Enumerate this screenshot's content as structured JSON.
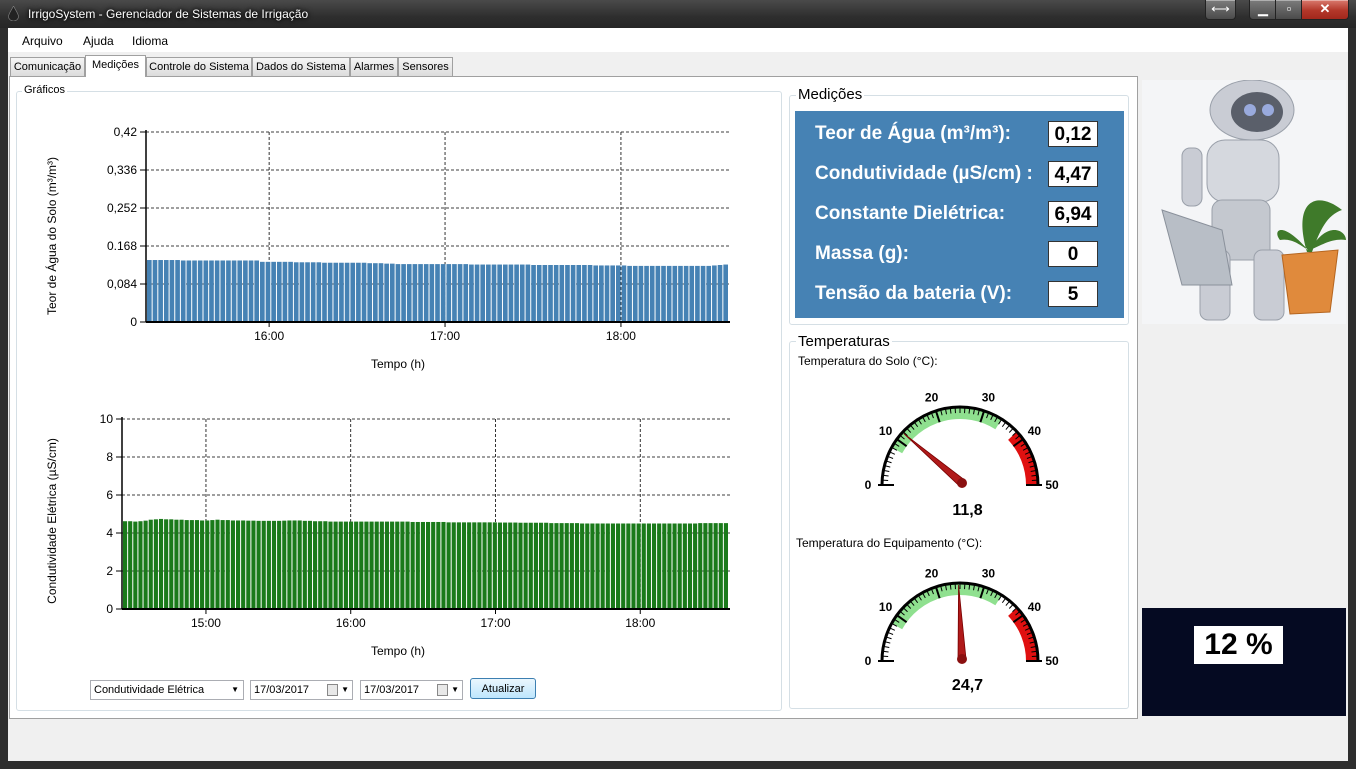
{
  "window": {
    "title": "IrrigoSystem - Gerenciador de Sistemas de Irrigação"
  },
  "menu": [
    "Arquivo",
    "Ajuda",
    "Idioma"
  ],
  "tabs": [
    "Comunicação",
    "Medições",
    "Controle do Sistema",
    "Dados do Sistema",
    "Alarmes",
    "Sensores"
  ],
  "active_tab": "Medições",
  "graphs_group": {
    "title": "Gráficos"
  },
  "chart_data": [
    {
      "type": "bar",
      "ylabel": "Teor de Água do Solo (m³/m³)",
      "xlabel": "Tempo (h)",
      "ylim": [
        0,
        0.42
      ],
      "yticks": [
        "0",
        "0,084",
        "0,252",
        "0,168",
        "0,252",
        "0,336",
        "0,42"
      ],
      "ytick_values": [
        0,
        0.084,
        0.168,
        0.252,
        0.336,
        0.42
      ],
      "ytick_labels": [
        "0",
        "0,084",
        "0.168",
        "0,252",
        "0,336",
        "0,42"
      ],
      "xtick_labels": [
        "16:00",
        "17:00",
        "18:00"
      ],
      "xtick_hours": [
        16,
        17,
        18
      ],
      "x_start_hour": 15.3,
      "x_end_hour": 18.62,
      "grid": true,
      "color": "#4682b4",
      "values": [
        0.137,
        0.137,
        0.137,
        0.137,
        0.137,
        0.137,
        0.136,
        0.136,
        0.136,
        0.136,
        0.136,
        0.136,
        0.136,
        0.136,
        0.136,
        0.136,
        0.136,
        0.136,
        0.136,
        0.136,
        0.133,
        0.133,
        0.133,
        0.133,
        0.133,
        0.133,
        0.132,
        0.132,
        0.132,
        0.132,
        0.132,
        0.131,
        0.131,
        0.131,
        0.131,
        0.131,
        0.131,
        0.131,
        0.131,
        0.13,
        0.13,
        0.13,
        0.129,
        0.129,
        0.128,
        0.128,
        0.128,
        0.128,
        0.128,
        0.128,
        0.128,
        0.128,
        0.128,
        0.128,
        0.128,
        0.128,
        0.128,
        0.127,
        0.127,
        0.127,
        0.127,
        0.127,
        0.127,
        0.127,
        0.127,
        0.127,
        0.127,
        0.127,
        0.126,
        0.126,
        0.126,
        0.126,
        0.126,
        0.126,
        0.126,
        0.126,
        0.126,
        0.126,
        0.126,
        0.125,
        0.125,
        0.125,
        0.125,
        0.125,
        0.125,
        0.124,
        0.124,
        0.124,
        0.124,
        0.124,
        0.124,
        0.124,
        0.124,
        0.124,
        0.124,
        0.124,
        0.124,
        0.124,
        0.124,
        0.124,
        0.125,
        0.126,
        0.127
      ]
    },
    {
      "type": "bar",
      "ylabel": "Condutividade Elétrica (µS/cm)",
      "xlabel": "Tempo (h)",
      "ylim": [
        0,
        10
      ],
      "ytick_values": [
        0,
        2,
        4,
        6,
        8,
        10
      ],
      "ytick_labels": [
        "0",
        "2",
        "4",
        "6",
        "8",
        "10"
      ],
      "xtick_labels": [
        "15:00",
        "16:00",
        "17:00",
        "18:00"
      ],
      "xtick_hours": [
        15,
        16,
        17,
        18
      ],
      "x_start_hour": 14.42,
      "x_end_hour": 18.62,
      "grid": true,
      "color": "#1a7a1a",
      "values": [
        4.62,
        4.62,
        4.6,
        4.62,
        4.65,
        4.7,
        4.72,
        4.74,
        4.72,
        4.72,
        4.7,
        4.7,
        4.68,
        4.68,
        4.68,
        4.66,
        4.66,
        4.68,
        4.7,
        4.68,
        4.68,
        4.66,
        4.66,
        4.66,
        4.65,
        4.65,
        4.64,
        4.64,
        4.64,
        4.64,
        4.64,
        4.65,
        4.66,
        4.66,
        4.66,
        4.64,
        4.64,
        4.62,
        4.62,
        4.62,
        4.6,
        4.6,
        4.6,
        4.6,
        4.6,
        4.6,
        4.6,
        4.6,
        4.6,
        4.6,
        4.6,
        4.6,
        4.6,
        4.6,
        4.6,
        4.6,
        4.58,
        4.58,
        4.58,
        4.58,
        4.58,
        4.58,
        4.58,
        4.56,
        4.56,
        4.56,
        4.56,
        4.56,
        4.56,
        4.56,
        4.56,
        4.56,
        4.56,
        4.55,
        4.55,
        4.55,
        4.55,
        4.54,
        4.54,
        4.54,
        4.54,
        4.54,
        4.54,
        4.52,
        4.52,
        4.52,
        4.52,
        4.52,
        4.52,
        4.5,
        4.5,
        4.5,
        4.5,
        4.5,
        4.5,
        4.5,
        4.5,
        4.5,
        4.5,
        4.5,
        4.5,
        4.5,
        4.5,
        4.5,
        4.5,
        4.5,
        4.5,
        4.5,
        4.5,
        4.5,
        4.5,
        4.5,
        4.52,
        4.52,
        4.52,
        4.52,
        4.52,
        4.52
      ]
    }
  ],
  "controls": {
    "measure_select": "Condutividade Elétrica",
    "date_from": "17/03/2017",
    "date_to": "17/03/2017",
    "update_button": "Atualizar"
  },
  "measurements": {
    "title": "Medições",
    "items": [
      {
        "label": "Teor de Água (m³/m³):",
        "value": "0,12"
      },
      {
        "label": "Condutividade (µS/cm) :",
        "value": "4,47"
      },
      {
        "label": "Constante Dielétrica:",
        "value": "6,94"
      },
      {
        "label": "Massa (g):",
        "value": "0"
      },
      {
        "label": "Tensão da bateria (V):",
        "value": "5"
      }
    ],
    "panel_color": "#4682b4"
  },
  "temperatures": {
    "title": "Temperaturas",
    "soil": {
      "label": "Temperatura do Solo (°C):",
      "value": 11.8,
      "value_text": "11,8"
    },
    "equipment": {
      "label": "Temperatura do Equipamento (°C):",
      "value": 24.7,
      "value_text": "24,7"
    },
    "gauge_ticks": [
      "0",
      "10",
      "20",
      "30",
      "40",
      "50"
    ],
    "gauge_min": 0,
    "gauge_max": 50,
    "green_range": [
      8,
      34
    ],
    "red_range": [
      38,
      50
    ]
  },
  "battery_display": {
    "text": "12 %"
  }
}
